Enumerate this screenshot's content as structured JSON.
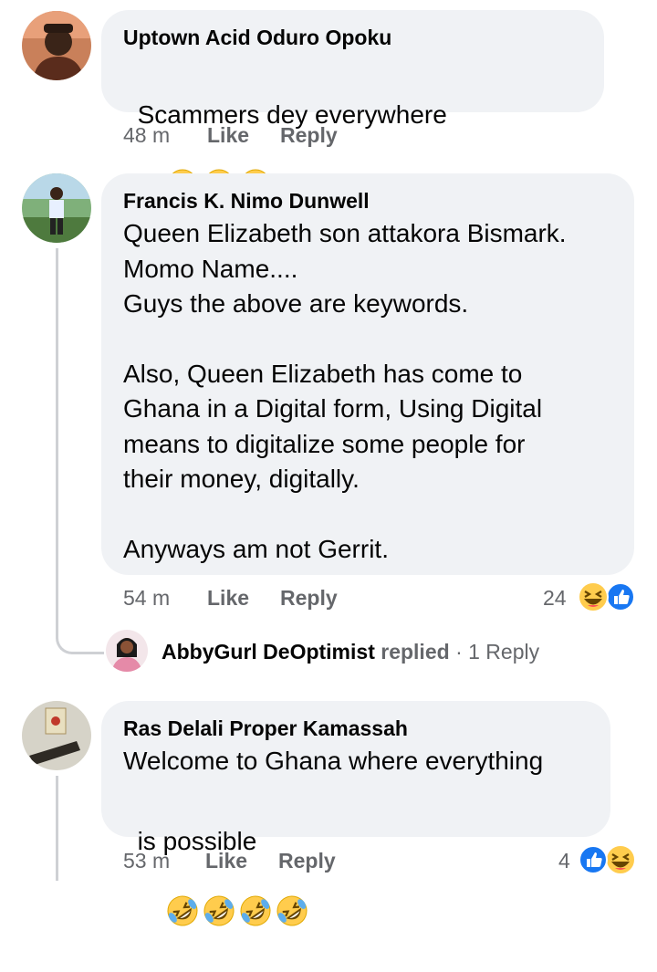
{
  "comments": [
    {
      "author": "Uptown Acid Oduro Opoku",
      "text": "Scammers dey everywhere",
      "emojis": [
        "laughing-tears",
        "laughing-tears",
        "laughing-tears"
      ],
      "time": "48 m",
      "like": "Like",
      "reply": "Reply"
    },
    {
      "author": "Francis K. Nimo Dunwell",
      "lines": [
        "Queen Elizabeth son attakora Bismark.",
        "Momo Name....",
        "Guys the above are keywords.",
        "",
        "Also, Queen Elizabeth has come to",
        "Ghana in a Digital form, Using Digital",
        "means to digitalize some people for",
        "their money, digitally.",
        "",
        "Anyways am not Gerrit."
      ],
      "time": "54 m",
      "like": "Like",
      "reply": "Reply",
      "reaction_count": "24",
      "reactions": [
        "haha",
        "like"
      ]
    },
    {
      "author": "Ras Delali Proper Kamassah",
      "text_line1": "Welcome to Ghana where everything",
      "text_line2": "is possible",
      "emojis": [
        "rofl",
        "rofl",
        "rofl",
        "rofl"
      ],
      "time": "53 m",
      "like": "Like",
      "reply": "Reply",
      "reaction_count": "4",
      "reactions": [
        "like",
        "haha"
      ]
    }
  ],
  "reply_summary": {
    "author": "AbbyGurl DeOptimist",
    "action": "replied",
    "separator": "·",
    "count_label": "1 Reply"
  },
  "colors": {
    "bubble": "#f0f2f5",
    "meta": "#65676b",
    "like_blue": "#1877f2",
    "emoji_yellow": "#ffcc4d"
  }
}
